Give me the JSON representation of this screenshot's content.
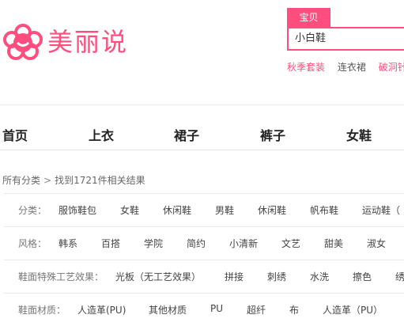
{
  "logo": {
    "text": "美丽说"
  },
  "search": {
    "tab_label": "宝贝",
    "query": "小白鞋"
  },
  "hot_keywords": [
    "秋季套装",
    "连衣裙",
    "破洞针织"
  ],
  "nav": [
    "首页",
    "上衣",
    "裙子",
    "裤子",
    "女鞋"
  ],
  "breadcrumb": {
    "root": "所有分类",
    "separator": ">",
    "result": "找到1721件相关结果"
  },
  "filters": [
    {
      "label": "分类：",
      "options": [
        "服饰鞋包",
        "女鞋",
        "休闲鞋",
        "男鞋",
        "休闲鞋",
        "帆布鞋",
        "运动鞋（"
      ]
    },
    {
      "label": "风格：",
      "options": [
        "韩系",
        "百搭",
        "学院",
        "简约",
        "小清新",
        "文艺",
        "甜美",
        "淑女"
      ]
    },
    {
      "label": "鞋面特殊工艺效果：",
      "options": [
        "光板（无工艺效果）",
        "拼接",
        "刺绣",
        "水洗",
        "擦色",
        "绣"
      ]
    },
    {
      "label": "鞋面材质：",
      "options": [
        "人造革(PU)",
        "其他材质",
        "PU",
        "超纤",
        "布",
        "人造革（PU）"
      ]
    }
  ],
  "colors": {
    "brand": "#ff4e7e"
  }
}
